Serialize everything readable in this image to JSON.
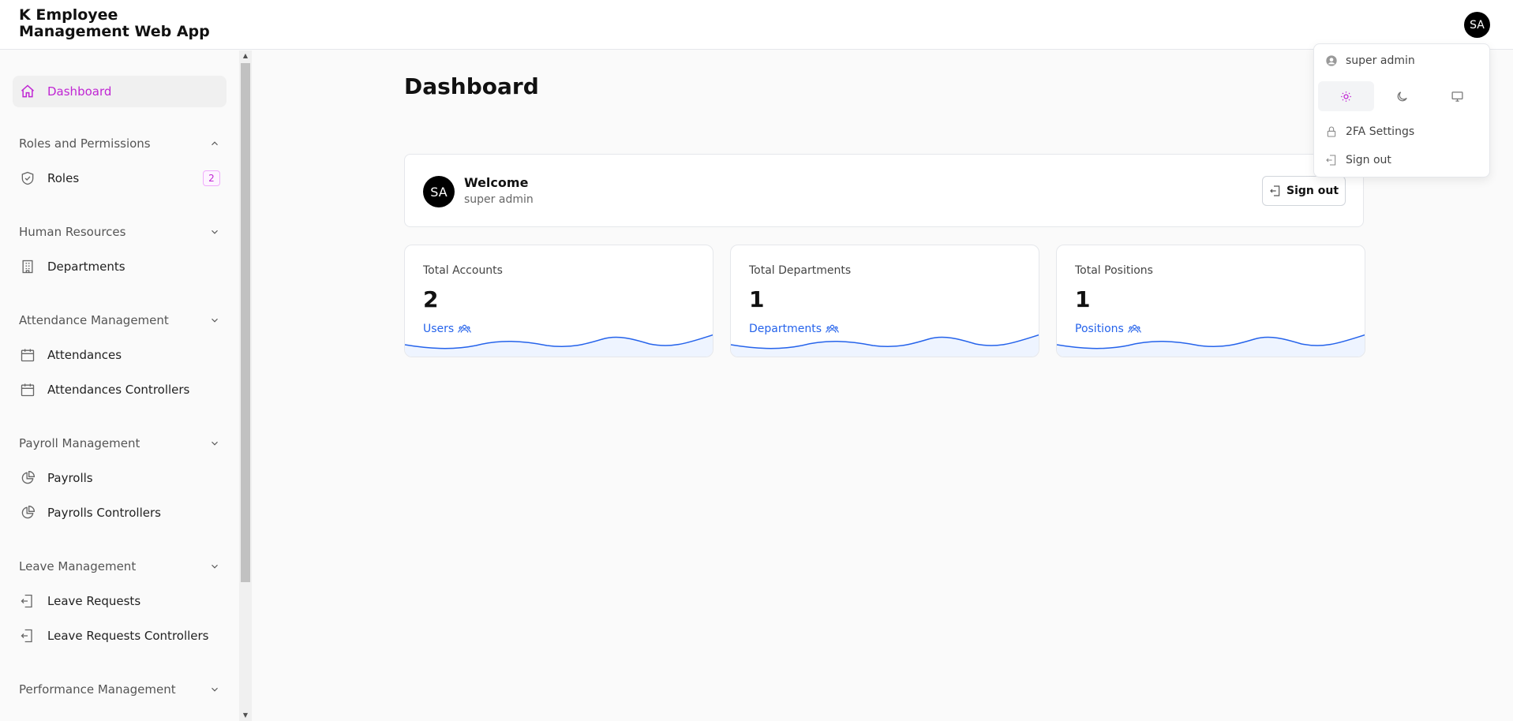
{
  "app": {
    "title": "K Employee Management Web App",
    "avatar_initials": "SA"
  },
  "sidebar": {
    "dashboard": "Dashboard",
    "sections": [
      {
        "label": "Roles and Permissions",
        "items": [
          {
            "label": "Roles",
            "badge": "2"
          }
        ]
      },
      {
        "label": "Human Resources",
        "items": [
          {
            "label": "Departments"
          }
        ]
      },
      {
        "label": "Attendance Management",
        "items": [
          {
            "label": "Attendances"
          },
          {
            "label": "Attendances Controllers"
          }
        ]
      },
      {
        "label": "Payroll Management",
        "items": [
          {
            "label": "Payrolls"
          },
          {
            "label": "Payrolls Controllers"
          }
        ]
      },
      {
        "label": "Leave Management",
        "items": [
          {
            "label": "Leave Requests"
          },
          {
            "label": "Leave Requests Controllers"
          }
        ]
      },
      {
        "label": "Performance Management",
        "items": []
      }
    ]
  },
  "main": {
    "title": "Dashboard",
    "welcome": {
      "initials": "SA",
      "title": "Welcome",
      "user": "super admin",
      "signout": "Sign out"
    },
    "stats": [
      {
        "label": "Total Accounts",
        "value": "2",
        "link": "Users"
      },
      {
        "label": "Total Departments",
        "value": "1",
        "link": "Departments"
      },
      {
        "label": "Total Positions",
        "value": "1",
        "link": "Positions"
      }
    ]
  },
  "dropdown": {
    "user": "super admin",
    "twofa": "2FA Settings",
    "signout": "Sign out"
  },
  "colors": {
    "accent": "#c026d3",
    "link": "#2563eb"
  }
}
